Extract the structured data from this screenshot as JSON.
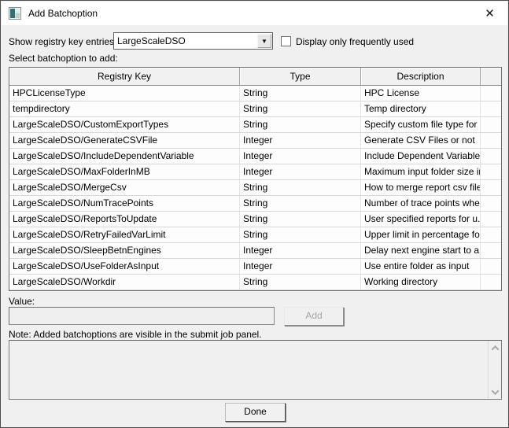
{
  "window": {
    "title": "Add Batchoption"
  },
  "icons": {
    "close": "✕",
    "dropdown_arrow": "▼"
  },
  "form": {
    "registry_label": "Show registry key entries:",
    "registry_selected": "LargeScaleDSO",
    "frequently_used_label": "Display only frequently used",
    "frequently_used_checked": false,
    "select_label": "Select batchoption to add:"
  },
  "table": {
    "columns": [
      "Registry Key",
      "Type",
      "Description"
    ],
    "rows": [
      {
        "key": "HPCLicenseType",
        "type": "String",
        "description": "HPC License"
      },
      {
        "key": "tempdirectory",
        "type": "String",
        "description": "Temp directory"
      },
      {
        "key": "LargeScaleDSO/CustomExportTypes",
        "type": "String",
        "description": "Specify custom file type for ..."
      },
      {
        "key": "LargeScaleDSO/GenerateCSVFile",
        "type": "Integer",
        "description": "Generate CSV Files or not"
      },
      {
        "key": "LargeScaleDSO/IncludeDependentVariable",
        "type": "Integer",
        "description": "Include Dependent Variable ..."
      },
      {
        "key": "LargeScaleDSO/MaxFolderInMB",
        "type": "Integer",
        "description": "Maximum input folder size in..."
      },
      {
        "key": "LargeScaleDSO/MergeCsv",
        "type": "String",
        "description": "How to merge report csv files"
      },
      {
        "key": "LargeScaleDSO/NumTracePoints",
        "type": "String",
        "description": "Number of trace points whe..."
      },
      {
        "key": "LargeScaleDSO/ReportsToUpdate",
        "type": "String",
        "description": "User specified reports for u..."
      },
      {
        "key": "LargeScaleDSO/RetryFailedVarLimit",
        "type": "String",
        "description": "Upper limit in percentage fo..."
      },
      {
        "key": "LargeScaleDSO/SleepBetnEngines",
        "type": "Integer",
        "description": "Delay next engine start to a..."
      },
      {
        "key": "LargeScaleDSO/UseFolderAsInput",
        "type": "Integer",
        "description": "Use entire folder as input"
      },
      {
        "key": "LargeScaleDSO/Workdir",
        "type": "String",
        "description": "Working directory"
      }
    ]
  },
  "value_section": {
    "label": "Value:",
    "input_value": "",
    "add_button": "Add"
  },
  "note": "Note: Added batchoptions are visible in the submit job panel.",
  "done_button": "Done",
  "colors": {
    "titlebar": "#ffffff",
    "body": "#f0f0f0",
    "row_bg": "#fdfdfd",
    "icon_teal": "#2e7372",
    "disabled_text": "#a6a6a6"
  }
}
